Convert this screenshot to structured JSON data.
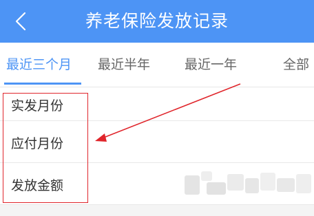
{
  "header": {
    "title": "养老保险发放记录",
    "back_icon": "chevron-left-icon",
    "background_color": "#4d94f5"
  },
  "tabs": [
    {
      "label": "最近三个月",
      "active": true
    },
    {
      "label": "最近半年",
      "active": false
    },
    {
      "label": "最近一年",
      "active": false
    },
    {
      "label": "全部",
      "active": false
    }
  ],
  "rows": [
    {
      "label": "实发月份"
    },
    {
      "label": "应付月份"
    },
    {
      "label": "发放金额"
    }
  ],
  "annotation": {
    "box_color": "#e0252b",
    "arrow_color": "#e0252b"
  }
}
